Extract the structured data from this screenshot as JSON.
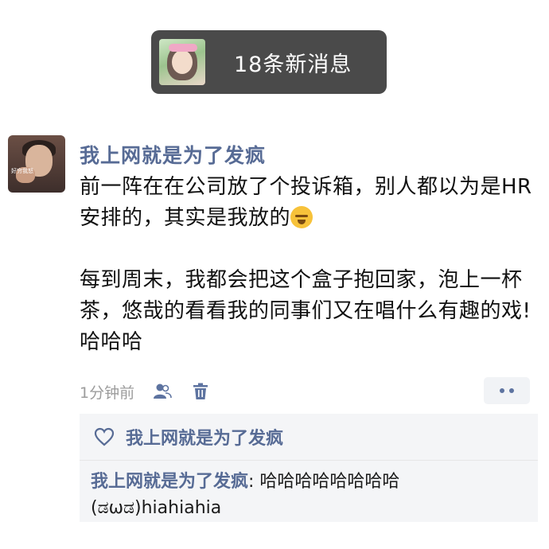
{
  "notice": {
    "text": "18条新消息"
  },
  "post": {
    "author": "我上网就是为了发疯",
    "avatar_tag": "好穷我怒",
    "paragraphs": [
      "前一阵在在公司放了个投诉箱，别人都以为是HR安排的，其实是我放的",
      "每到周末，我都会把这个盒子抱回家，泡上一杯茶，悠哉的看看我的同事们又在唱什么有趣的戏!哈哈哈"
    ],
    "emoji": "laughing-crying-emoji",
    "time": "1分钟前",
    "icons": {
      "privacy": "person-group-icon",
      "delete": "trash-icon",
      "more": "more-dots-icon"
    }
  },
  "feedback": {
    "like_icon": "heart-outline-icon",
    "likes_names": "我上网就是为了发疯",
    "comments": [
      {
        "author": "我上网就是为了发疯",
        "separator": ": ",
        "text": "哈哈哈哈哈哈哈哈(ಡωಡ)hiahiahia"
      }
    ]
  },
  "colors": {
    "link_blue": "#576b95",
    "notice_bg": "#4a4a4a",
    "feedback_bg": "#f4f5f7"
  }
}
